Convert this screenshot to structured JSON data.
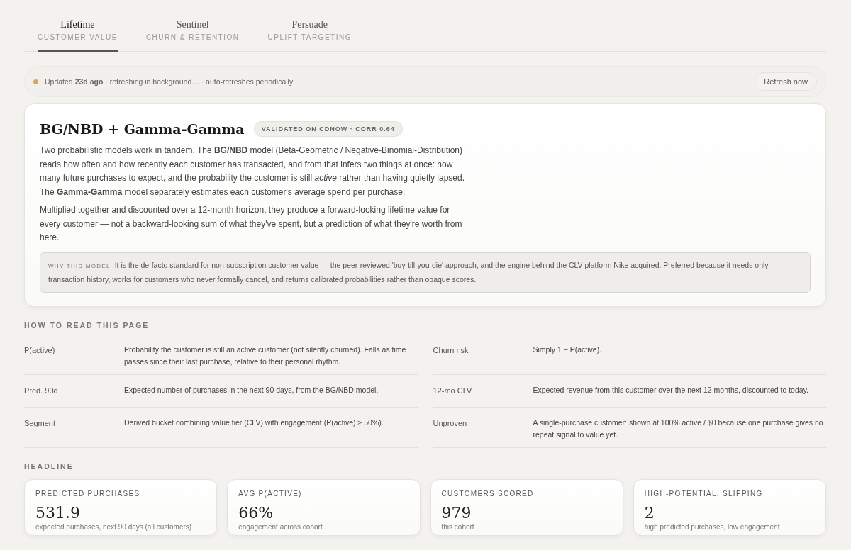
{
  "tabs": [
    {
      "label": "Lifetime",
      "sublabel": "CUSTOMER VALUE",
      "selected": true
    },
    {
      "label": "Sentinel",
      "sublabel": "CHURN & RETENTION",
      "selected": false
    },
    {
      "label": "Persuade",
      "sublabel": "UPLIFT TARGETING",
      "selected": false
    }
  ],
  "status_bar": {
    "refreshing": true,
    "text": "Updated **23d ago** · refreshing in background… · auto-refreshes periodically",
    "button": "Refresh now"
  },
  "model_card": {
    "title": "BG/NBD + Gamma-Gamma",
    "badge": "VALIDATED ON CDNOW · CORR 0.64",
    "paragraphs": [
      "Two probabilistic models work in tandem. The **BG/NBD** model (Beta-Geometric / Negative-Binomial-Distribution) reads how often and how recently each customer has transacted, and from that infers two things at once: how many future purchases to expect, and the probability the customer is still *active* rather than having quietly lapsed. The **Gamma-Gamma** model separately estimates each customer's average spend per purchase.",
      "Multiplied together and discounted over a 12-month horizon, they produce a forward-looking lifetime value for every customer — not a backward-looking sum of what they've spent, but a prediction of what they're worth from here."
    ],
    "note_label": "WHY THIS MODEL",
    "note": "It is the de-facto standard for non-subscription customer value — the peer-reviewed 'buy-till-you-die' approach, and the engine behind the CLV platform Nike acquired. Preferred because it needs only transaction history, works for customers who never formally cancel, and returns calibrated probabilities rather than opaque scores."
  },
  "glossary": {
    "heading": "HOW TO READ THIS PAGE",
    "items": [
      {
        "term": "P(active)",
        "definition": "Probability the customer is still an active customer (not silently churned). Falls as time passes since their last purchase, relative to their personal rhythm."
      },
      {
        "term": "Churn risk",
        "definition": "Simply 1 − P(active)."
      },
      {
        "term": "Pred. 90d",
        "definition": "Expected number of purchases in the next 90 days, from the BG/NBD model."
      },
      {
        "term": "12-mo CLV",
        "definition": "Expected revenue from this customer over the next 12 months, discounted to today."
      },
      {
        "term": "Segment",
        "definition": "Derived bucket combining value tier (CLV) with engagement (P(active) ≥ 50%)."
      },
      {
        "term": "Unproven",
        "definition": "A single-purchase customer: shown at 100% active / $0 because one purchase gives no repeat signal to value yet."
      }
    ]
  },
  "headline": {
    "heading": "HEADLINE",
    "cards": [
      {
        "label": "PREDICTED PURCHASES",
        "value": "531.9",
        "caption": "expected purchases, next 90 days (all customers)"
      },
      {
        "label": "AVG P(ACTIVE)",
        "value": "66%",
        "caption": "engagement across cohort"
      },
      {
        "label": "CUSTOMERS SCORED",
        "value": "979",
        "caption": "this cohort"
      },
      {
        "label": "HIGH-POTENTIAL, SLIPPING",
        "value": "2",
        "caption": "high predicted purchases, low engagement"
      }
    ]
  }
}
